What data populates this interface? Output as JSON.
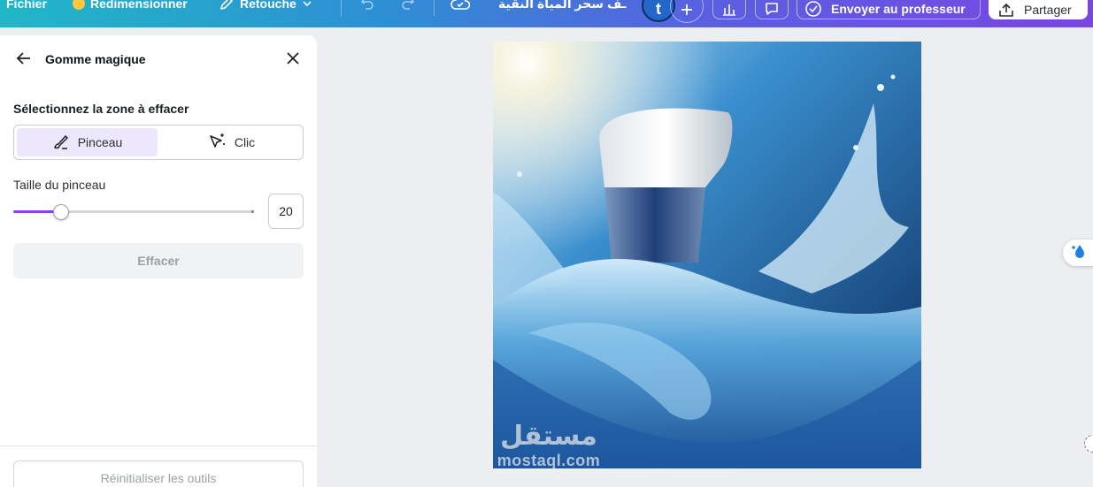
{
  "topbar": {
    "file_label": "Fichier",
    "resize_label": "Redimensionner",
    "edit_label": "Retouche",
    "doc_title": "ـف سحر المياة النقية",
    "avatar_initial": "t",
    "add_icon": "plus-icon",
    "stats_icon": "bar-chart-icon",
    "comment_icon": "comment-icon",
    "send_label": "Envoyer au professeur",
    "share_label": "Partager"
  },
  "panel": {
    "title": "Gomme magique",
    "section_label": "Sélectionnez la zone à effacer",
    "modes": [
      {
        "label": "Pinceau",
        "icon": "brush-icon",
        "selected": true
      },
      {
        "label": "Clic",
        "icon": "magic-cursor-icon",
        "selected": false
      }
    ],
    "brush_size_label": "Taille du pinceau",
    "brush_size_value": "20",
    "brush_size_fraction": 0.2,
    "erase_label": "Effacer",
    "reset_label": "Réinitialiser les outils"
  },
  "canvas": {
    "image_subject": "water-filter-product-photo",
    "watermark_arabic": "مستقل",
    "watermark_latin": "mostaql.com"
  },
  "colors": {
    "accent": "#8b3dff",
    "selected_mode_bg": "#ece7fb",
    "topbar_start": "#20b7c8",
    "topbar_end": "#7a45e6"
  }
}
